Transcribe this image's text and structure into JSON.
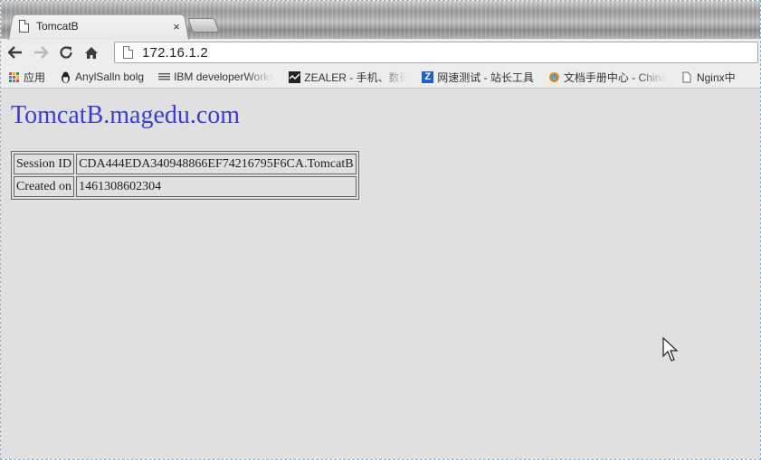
{
  "tab": {
    "title": "TomcatB",
    "close_glyph": "×"
  },
  "toolbar": {
    "back_icon": "arrow-left-icon",
    "forward_icon": "arrow-right-icon",
    "reload_icon": "reload-icon",
    "home_icon": "home-icon",
    "url": "172.16.1.2"
  },
  "bookmarks": [
    {
      "label": "应用",
      "icon": "apps-grid-icon"
    },
    {
      "label": "AnylSalln bolg",
      "icon": "penguin-icon"
    },
    {
      "label": "IBM developerWorks",
      "icon": "ibm-icon"
    },
    {
      "label": "ZEALER - 手机、数码",
      "icon": "zealer-icon"
    },
    {
      "label": "网速测试 - 站长工具",
      "icon": "chinaz-icon"
    },
    {
      "label": "文档手册中心 - China",
      "icon": "doc-center-icon"
    },
    {
      "label": "Nginx中",
      "icon": "page-icon"
    }
  ],
  "page": {
    "heading": "TomcatB.magedu.com",
    "rows": [
      {
        "label": "Session ID",
        "value": "CDA444EDA340948866EF74216795F6CA.TomcatB"
      },
      {
        "label": "Created on",
        "value": "1461308602304"
      }
    ]
  },
  "colors": {
    "heading": "#3b3bd8",
    "page_bg": "#e0e0e0",
    "chrome_bg": "#ededed"
  }
}
